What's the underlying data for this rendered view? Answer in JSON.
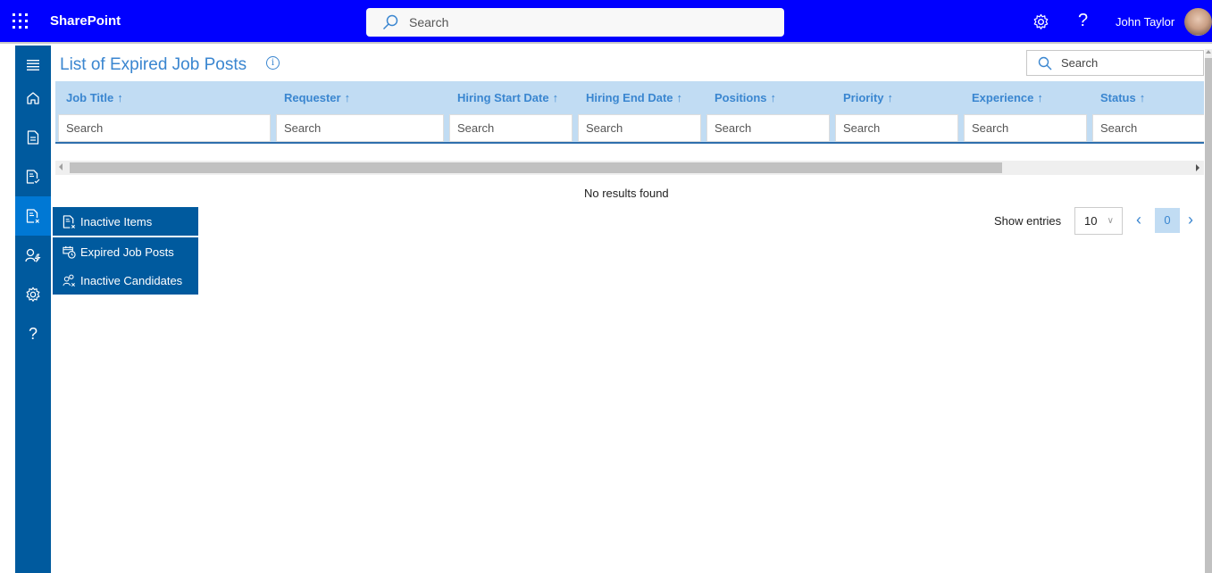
{
  "header": {
    "app_name": "SharePoint",
    "search_placeholder": "Search",
    "user_name": "John Taylor",
    "brand_color": "#0000ff"
  },
  "nav": {
    "items": [
      {
        "icon": "hamburger-icon"
      },
      {
        "icon": "home-icon"
      },
      {
        "icon": "document-icon"
      },
      {
        "icon": "document-check-icon"
      },
      {
        "icon": "document-x-icon",
        "active": true
      },
      {
        "icon": "person-bolt-icon"
      },
      {
        "icon": "gear-icon"
      },
      {
        "icon": "help-icon",
        "glyph": "?"
      }
    ],
    "bg_color": "#005a9e"
  },
  "flyout": {
    "header": "Inactive Items",
    "items": [
      "Expired Job Posts",
      "Inactive Candidates"
    ]
  },
  "page": {
    "title": "List of Expired Job Posts",
    "info_glyph": "i",
    "search_placeholder": "Search",
    "no_results": "No results found",
    "accent_color": "#3a86d0"
  },
  "grid": {
    "sort_arrow": "↑",
    "columns": [
      {
        "label": "Job Title",
        "filter_placeholder": "Search"
      },
      {
        "label": "Requester",
        "filter_placeholder": "Search"
      },
      {
        "label": "Hiring Start Date",
        "filter_placeholder": "Search"
      },
      {
        "label": "Hiring End Date",
        "filter_placeholder": "Search"
      },
      {
        "label": "Positions",
        "filter_placeholder": "Search"
      },
      {
        "label": "Priority",
        "filter_placeholder": "Search"
      },
      {
        "label": "Experience",
        "filter_placeholder": "Search"
      },
      {
        "label": "Status",
        "filter_placeholder": "Search"
      }
    ],
    "header_bg": "#c1dcf3"
  },
  "pagination": {
    "show_entries_label": "Show entries",
    "entries_value": "10",
    "current_page": "0",
    "prev_glyph": "‹",
    "next_glyph": "›"
  }
}
